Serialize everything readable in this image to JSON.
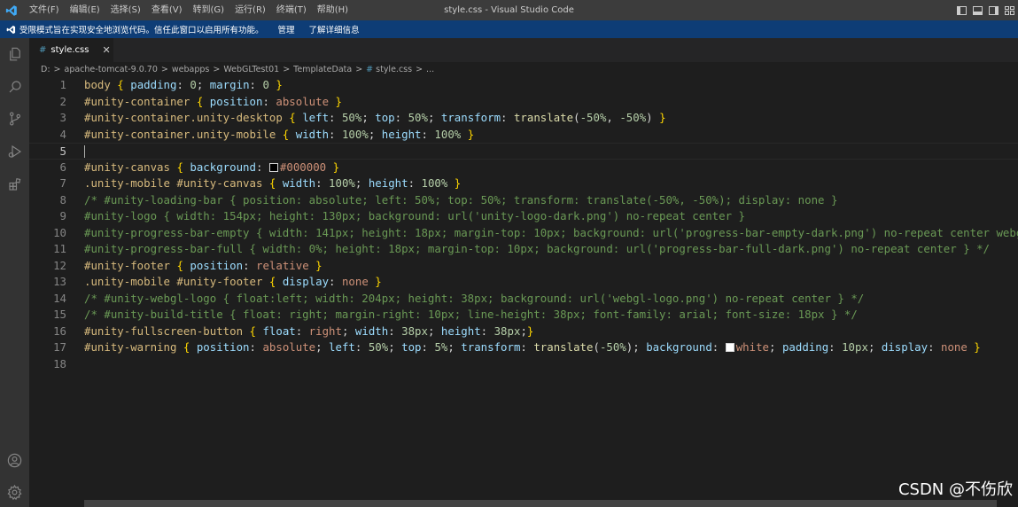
{
  "window": {
    "title": "style.css - Visual Studio Code",
    "menu": [
      "文件(F)",
      "编辑(E)",
      "选择(S)",
      "查看(V)",
      "转到(G)",
      "运行(R)",
      "终端(T)",
      "帮助(H)"
    ]
  },
  "banner": {
    "text": "受限模式旨在实现安全地浏览代码。信任此窗口以启用所有功能。",
    "manage_label": "管理",
    "learn_more_label": "了解详细信息"
  },
  "activity_bar": [
    "explorer-icon",
    "search-icon",
    "source-control-icon",
    "run-debug-icon",
    "extensions-icon",
    "accounts-icon",
    "settings-gear-icon"
  ],
  "tab": {
    "label": "style.css",
    "close_glyph": "✕"
  },
  "breadcrumb": {
    "items": [
      "D:",
      "apache-tomcat-9.0.70",
      "webapps",
      "WebGLTest01",
      "TemplateData",
      "style.css",
      "..."
    ]
  },
  "editor": {
    "cursor_line": 5,
    "lines": [
      {
        "n": "1",
        "tokens": [
          [
            "sel",
            "body"
          ],
          [
            "br",
            " { "
          ],
          [
            "pr",
            "padding"
          ],
          [
            "pn",
            ": "
          ],
          [
            "num",
            "0"
          ],
          [
            "pn",
            "; "
          ],
          [
            "pr",
            "margin"
          ],
          [
            "pn",
            ": "
          ],
          [
            "num",
            "0"
          ],
          [
            "br",
            " }"
          ]
        ]
      },
      {
        "n": "2",
        "tokens": [
          [
            "sel",
            "#unity-container"
          ],
          [
            "br",
            " { "
          ],
          [
            "pr",
            "position"
          ],
          [
            "pn",
            ": "
          ],
          [
            "val",
            "absolute"
          ],
          [
            "br",
            " }"
          ]
        ]
      },
      {
        "n": "3",
        "tokens": [
          [
            "sel",
            "#unity-container.unity-desktop"
          ],
          [
            "br",
            " { "
          ],
          [
            "pr",
            "left"
          ],
          [
            "pn",
            ": "
          ],
          [
            "num",
            "50%"
          ],
          [
            "pn",
            "; "
          ],
          [
            "pr",
            "top"
          ],
          [
            "pn",
            ": "
          ],
          [
            "num",
            "50%"
          ],
          [
            "pn",
            "; "
          ],
          [
            "pr",
            "transform"
          ],
          [
            "pn",
            ": "
          ],
          [
            "fn",
            "translate"
          ],
          [
            "pn",
            "("
          ],
          [
            "num",
            "-50%"
          ],
          [
            "pn",
            ", "
          ],
          [
            "num",
            "-50%"
          ],
          [
            "pn",
            ")"
          ],
          [
            "br",
            " }"
          ]
        ]
      },
      {
        "n": "4",
        "tokens": [
          [
            "sel",
            "#unity-container.unity-mobile"
          ],
          [
            "br",
            " { "
          ],
          [
            "pr",
            "width"
          ],
          [
            "pn",
            ": "
          ],
          [
            "num",
            "100%"
          ],
          [
            "pn",
            "; "
          ],
          [
            "pr",
            "height"
          ],
          [
            "pn",
            ": "
          ],
          [
            "num",
            "100%"
          ],
          [
            "br",
            " }"
          ]
        ]
      },
      {
        "n": "5",
        "tokens": []
      },
      {
        "n": "6",
        "tokens": [
          [
            "sel",
            "#unity-canvas"
          ],
          [
            "br",
            " { "
          ],
          [
            "pr",
            "background"
          ],
          [
            "pn",
            ": "
          ],
          [
            "swatch",
            "#000000"
          ],
          [
            "val",
            "#000000"
          ],
          [
            "br",
            " }"
          ]
        ]
      },
      {
        "n": "7",
        "tokens": [
          [
            "sel",
            ".unity-mobile #unity-canvas"
          ],
          [
            "br",
            " { "
          ],
          [
            "pr",
            "width"
          ],
          [
            "pn",
            ": "
          ],
          [
            "num",
            "100%"
          ],
          [
            "pn",
            "; "
          ],
          [
            "pr",
            "height"
          ],
          [
            "pn",
            ": "
          ],
          [
            "num",
            "100%"
          ],
          [
            "br",
            " }"
          ]
        ]
      },
      {
        "n": "8",
        "tokens": [
          [
            "cm",
            "/* #unity-loading-bar { position: absolute; left: 50%; top: 50%; transform: translate(-50%, -50%); display: none }"
          ]
        ]
      },
      {
        "n": "9",
        "tokens": [
          [
            "cm",
            "#unity-logo { width: 154px; height: 130px; background: url('unity-logo-dark.png') no-repeat center }"
          ]
        ]
      },
      {
        "n": "10",
        "tokens": [
          [
            "cm",
            "#unity-progress-bar-empty { width: 141px; height: 18px; margin-top: 10px; background: url('progress-bar-empty-dark.png') no-repeat center webgl"
          ]
        ]
      },
      {
        "n": "11",
        "tokens": [
          [
            "cm",
            "#unity-progress-bar-full { width: 0%; height: 18px; margin-top: 10px; background: url('progress-bar-full-dark.png') no-repeat center } */"
          ]
        ]
      },
      {
        "n": "12",
        "tokens": [
          [
            "sel",
            "#unity-footer"
          ],
          [
            "br",
            " { "
          ],
          [
            "pr",
            "position"
          ],
          [
            "pn",
            ": "
          ],
          [
            "val",
            "relative"
          ],
          [
            "br",
            " }"
          ]
        ]
      },
      {
        "n": "13",
        "tokens": [
          [
            "sel",
            ".unity-mobile #unity-footer"
          ],
          [
            "br",
            " { "
          ],
          [
            "pr",
            "display"
          ],
          [
            "pn",
            ": "
          ],
          [
            "val",
            "none"
          ],
          [
            "br",
            " }"
          ]
        ]
      },
      {
        "n": "14",
        "tokens": [
          [
            "cm",
            "/* #unity-webgl-logo { float:left; width: 204px; height: 38px; background: url('webgl-logo.png') no-repeat center } */"
          ]
        ]
      },
      {
        "n": "15",
        "tokens": [
          [
            "cm",
            "/* #unity-build-title { float: right; margin-right: 10px; line-height: 38px; font-family: arial; font-size: 18px } */"
          ]
        ]
      },
      {
        "n": "16",
        "tokens": [
          [
            "sel",
            "#unity-fullscreen-button"
          ],
          [
            "br",
            " { "
          ],
          [
            "pr",
            "float"
          ],
          [
            "pn",
            ": "
          ],
          [
            "val",
            "right"
          ],
          [
            "pn",
            "; "
          ],
          [
            "pr",
            "width"
          ],
          [
            "pn",
            ": "
          ],
          [
            "num",
            "38px"
          ],
          [
            "pn",
            "; "
          ],
          [
            "pr",
            "height"
          ],
          [
            "pn",
            ": "
          ],
          [
            "num",
            "38px"
          ],
          [
            "pn",
            ";"
          ],
          [
            "br",
            "}"
          ]
        ]
      },
      {
        "n": "17",
        "tokens": [
          [
            "sel",
            "#unity-warning"
          ],
          [
            "br",
            " { "
          ],
          [
            "pr",
            "position"
          ],
          [
            "pn",
            ": "
          ],
          [
            "val",
            "absolute"
          ],
          [
            "pn",
            "; "
          ],
          [
            "pr",
            "left"
          ],
          [
            "pn",
            ": "
          ],
          [
            "num",
            "50%"
          ],
          [
            "pn",
            "; "
          ],
          [
            "pr",
            "top"
          ],
          [
            "pn",
            ": "
          ],
          [
            "num",
            "5%"
          ],
          [
            "pn",
            "; "
          ],
          [
            "pr",
            "transform"
          ],
          [
            "pn",
            ": "
          ],
          [
            "fn",
            "translate"
          ],
          [
            "pn",
            "("
          ],
          [
            "num",
            "-50%"
          ],
          [
            "pn",
            "); "
          ],
          [
            "pr",
            "background"
          ],
          [
            "pn",
            ": "
          ],
          [
            "swatch",
            "#ffffff"
          ],
          [
            "val",
            "white"
          ],
          [
            "pn",
            "; "
          ],
          [
            "pr",
            "padding"
          ],
          [
            "pn",
            ": "
          ],
          [
            "num",
            "10px"
          ],
          [
            "pn",
            "; "
          ],
          [
            "pr",
            "display"
          ],
          [
            "pn",
            ": "
          ],
          [
            "val",
            "none"
          ],
          [
            "br",
            " }"
          ]
        ]
      },
      {
        "n": "18",
        "tokens": []
      }
    ]
  },
  "watermark": "CSDN @不伤欣",
  "colors": {
    "titlebar": "#3c3c3c",
    "banner": "#0e3d76",
    "activity_bar": "#333333",
    "editor_bg": "#1e1e1e",
    "selector": "#d7ba7d",
    "property": "#9cdcfe",
    "number": "#b5cea8",
    "string_value": "#ce9178",
    "function": "#dcdcaa",
    "comment": "#6a9955",
    "bracket": "#ffd700",
    "css_file_icon": "#519aba"
  }
}
